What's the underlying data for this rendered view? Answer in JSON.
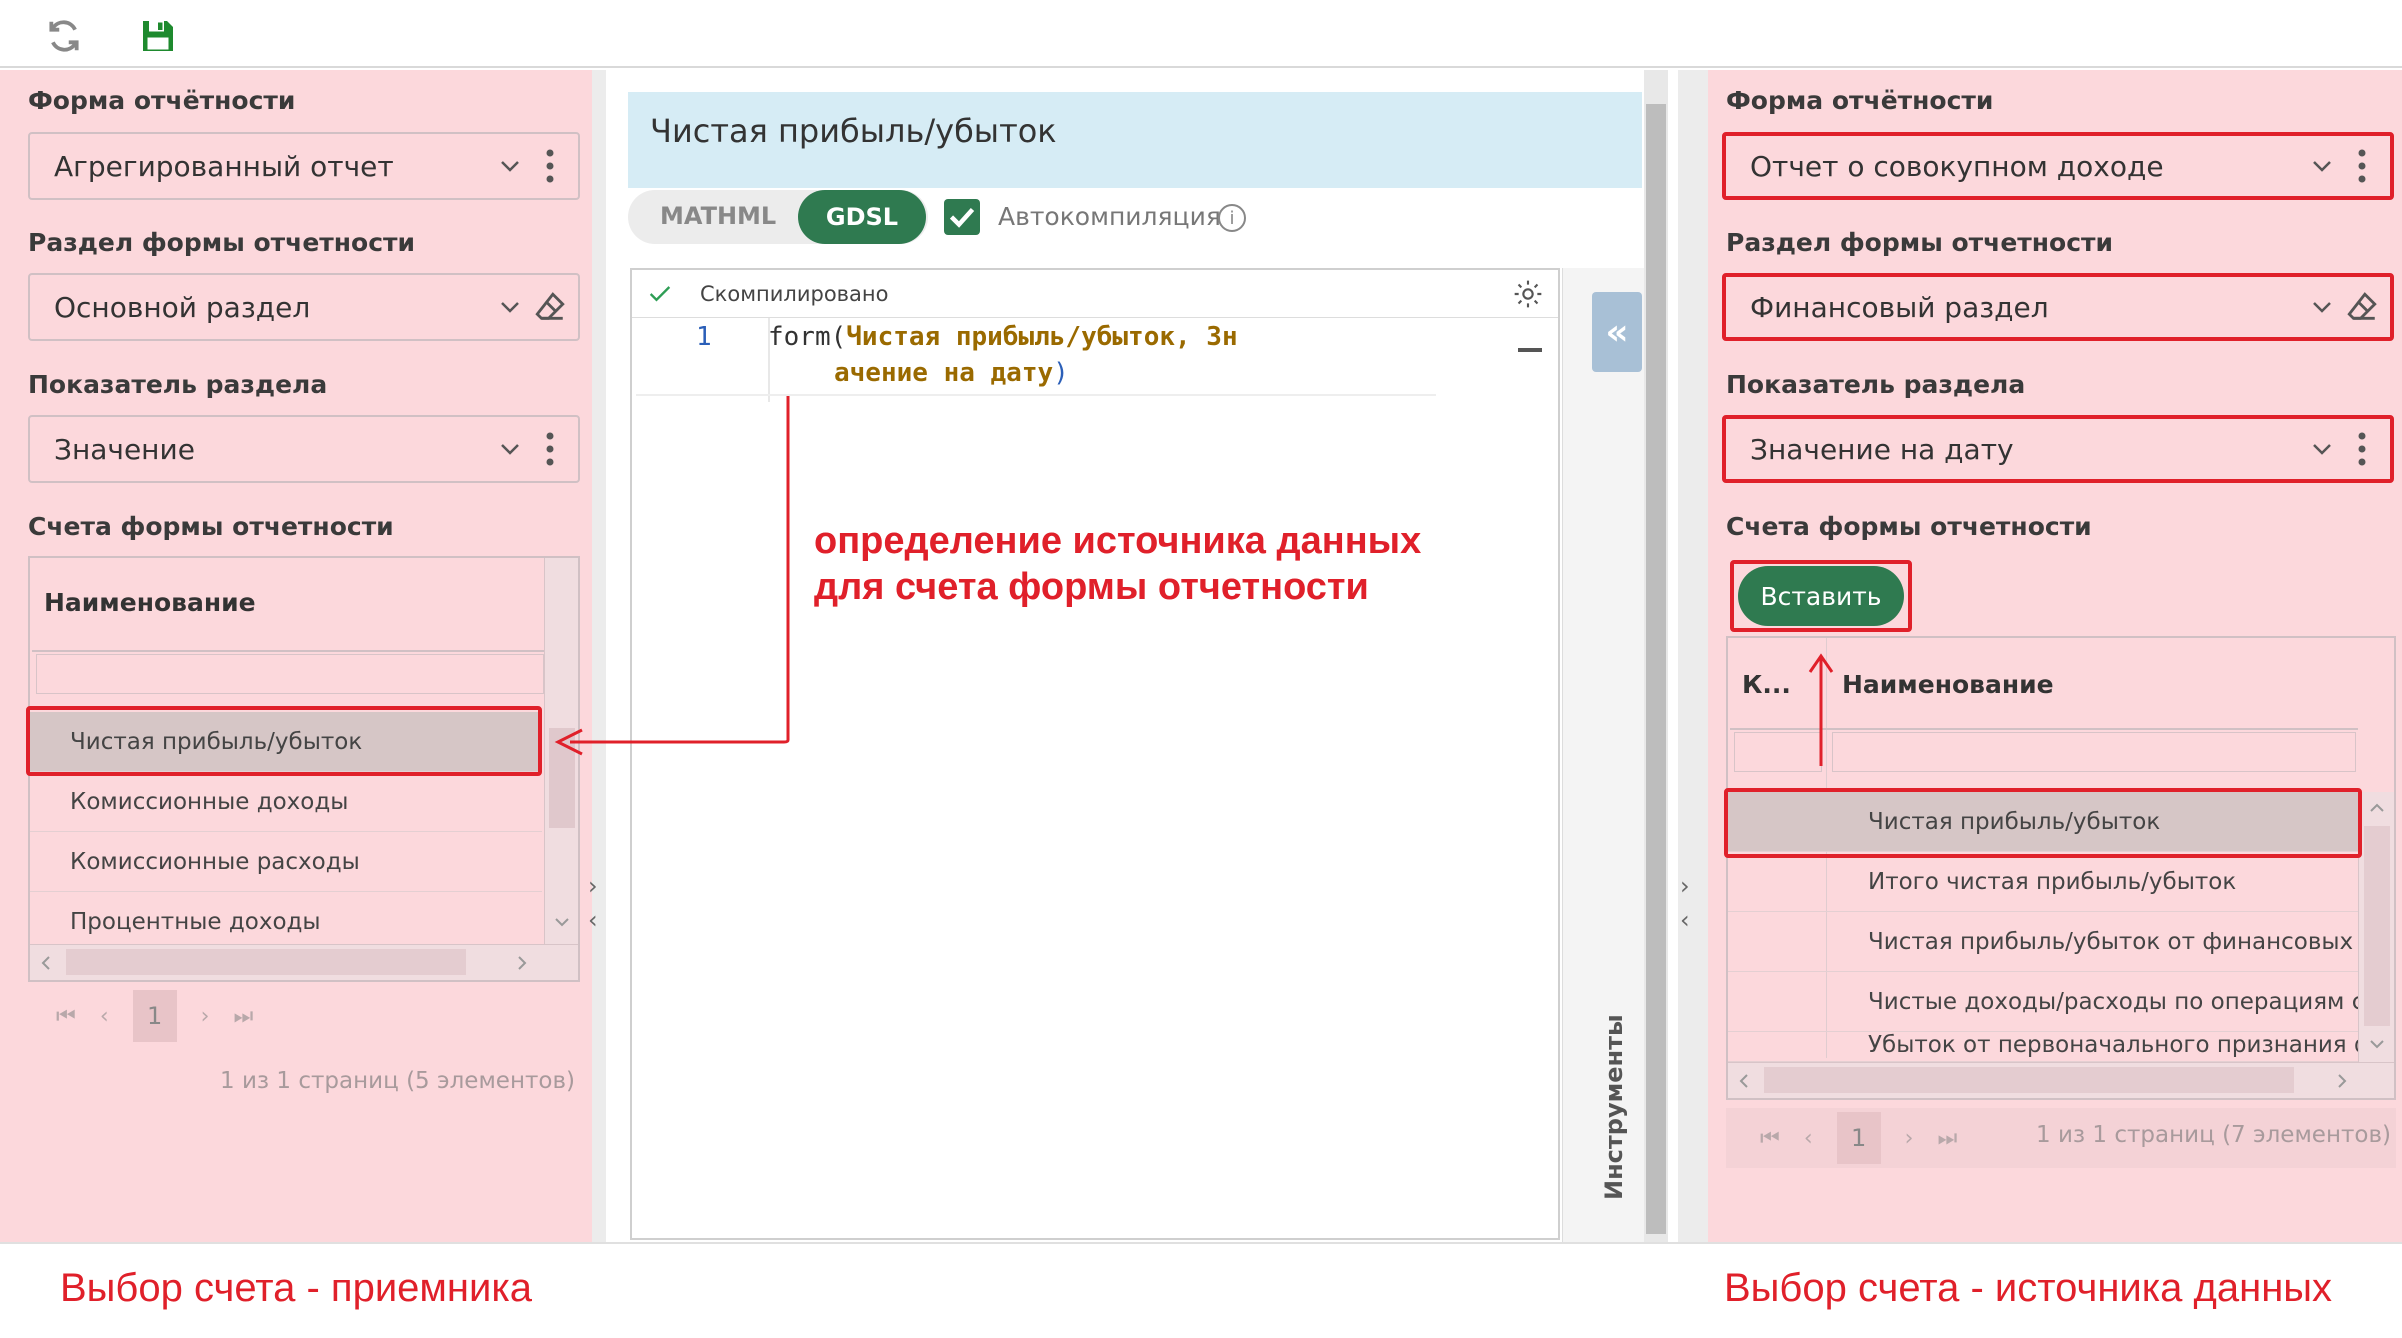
{
  "toolbar": {
    "refresh_icon": "refresh-icon",
    "save_icon": "save-icon"
  },
  "left": {
    "form_label": "Форма отчётности",
    "form_value": "Агрегированный отчет",
    "section_label": "Раздел формы отчетности",
    "section_value": "Основной раздел",
    "indicator_label": "Показатель раздела",
    "indicator_value": "Значение",
    "accounts_label": "Счета формы отчетности",
    "column_name": "Наименование",
    "rows": [
      "Чистая прибыль/убыток",
      "Комиссионные доходы",
      "Комиссионные расходы",
      "Процентные доходы"
    ],
    "page": "1",
    "page_info": "1 из 1 страниц (5 элементов)"
  },
  "center": {
    "title": "Чистая прибыль/убыток",
    "tab_mathml": "MATHML",
    "tab_gdsl": "GDSL",
    "autocompile_label": "Автокомпиляция",
    "compiled_status": "Скомпилировано",
    "line_number": "1",
    "code_fn": "form(",
    "code_arg1": "Чистая прибыль/убыток, Зн",
    "code_arg2": "ачение на дату",
    "code_close": ")",
    "tools_label": "Инструменты"
  },
  "right": {
    "form_label": "Форма отчётности",
    "form_value": "Отчет о совокупном доходе",
    "section_label": "Раздел формы отчетности",
    "section_value": "Финансовый раздел",
    "indicator_label": "Показатель раздела",
    "indicator_value": "Значение на дату",
    "accounts_label": "Счета формы отчетности",
    "insert_button": "Вставить",
    "column_code": "К...",
    "column_name": "Наименование",
    "rows": [
      "Чистая прибыль/убыток",
      "Итого чистая прибыль/убыток",
      "Чистая прибыль/убыток от финансовых о",
      "Чистые доходы/расходы по операциям с",
      "Убыток от первоначального признания фи"
    ],
    "page": "1",
    "page_info": "1 из 1 страниц (7 элементов)"
  },
  "annotations": {
    "data_source_line1": "определение источника данных",
    "data_source_line2": "для счета формы отчетности",
    "receiver_caption": "Выбор счета - приемника",
    "source_caption": "Выбор счета - источника данных"
  },
  "colors": {
    "accent_green": "#2f7a50",
    "highlight_red": "#e0202a",
    "panel_pink": "#fcd8dc"
  }
}
